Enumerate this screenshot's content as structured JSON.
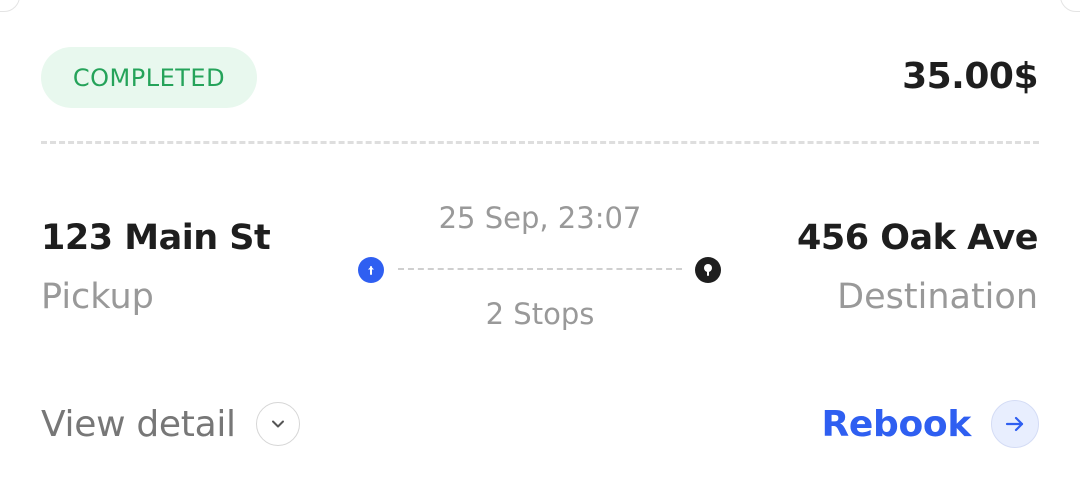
{
  "trip": {
    "status": "COMPLETED",
    "price": "35.00$",
    "datetime": "25 Sep, 23:07",
    "stops": "2 Stops"
  },
  "pickup": {
    "address": "123 Main St",
    "label": "Pickup"
  },
  "destination": {
    "address": "456 Oak Ave",
    "label": "Destination"
  },
  "actions": {
    "view_detail_label": "View detail",
    "rebook_label": "Rebook"
  },
  "icons": {
    "pickup_marker": "arrow-up-icon",
    "destination_marker": "location-pin-icon",
    "view_detail": "chevron-down-icon",
    "rebook": "arrow-right-icon"
  },
  "colors": {
    "status_text": "#25a35a",
    "status_bg": "#e8f8ee",
    "accent": "#2f5ff1",
    "text_primary": "#1e1e1e",
    "text_secondary": "#999999"
  }
}
